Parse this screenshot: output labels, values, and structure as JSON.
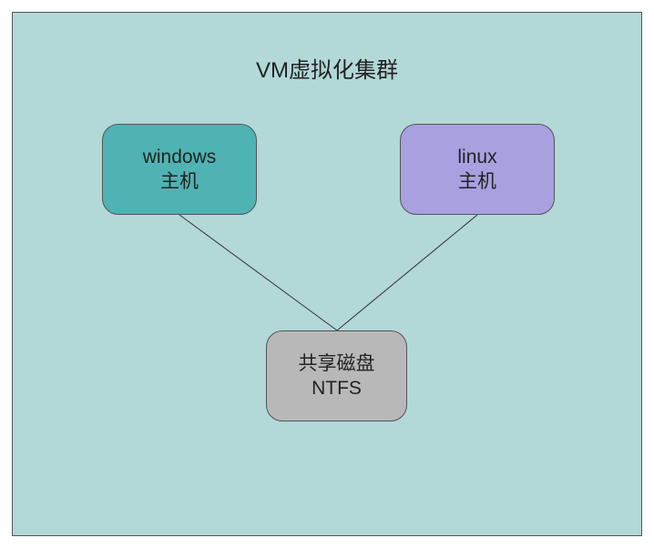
{
  "title": "VM虚拟化集群",
  "nodes": {
    "windows": {
      "line1": "windows",
      "line2": "主机"
    },
    "linux": {
      "line1": "linux",
      "line2": "主机"
    },
    "disk": {
      "line1": "共享磁盘",
      "line2": "NTFS"
    }
  }
}
